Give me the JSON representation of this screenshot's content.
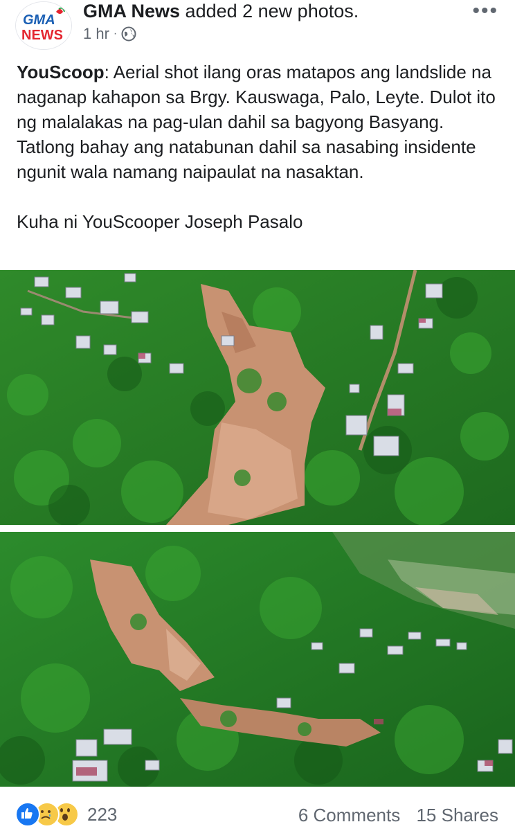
{
  "post": {
    "page_name": "GMA News",
    "action_text": "added 2 new photos.",
    "time": "1 hr",
    "separator": "·",
    "privacy_icon": "globe-icon",
    "more_icon": "more-options-icon",
    "logo_text_top": "GMA",
    "logo_text_bottom": "NEWS",
    "source_tag": "YouScoop",
    "body": ": Aerial shot ilang oras matapos ang landslide na naganap kahapon sa Brgy. Kauswaga, Palo, Leyte. Dulot ito ng malalakas na pag-ulan dahil sa bagyong Basyang. Tatlong bahay ang natabunan dahil sa nasabing insidente ngunit wala namang naipaulat na nasaktan.",
    "credit": "Kuha ni YouScooper Joseph Pasalo"
  },
  "footer": {
    "reaction_icons": [
      "like-icon",
      "sad-icon",
      "wow-icon"
    ],
    "reaction_count": "223",
    "comments": "6 Comments",
    "shares": "15 Shares"
  },
  "colors": {
    "brand_blue": "#1877f2",
    "gma_red": "#e4252f",
    "forest_green": "#2f7d2a",
    "soil": "#c89272"
  }
}
